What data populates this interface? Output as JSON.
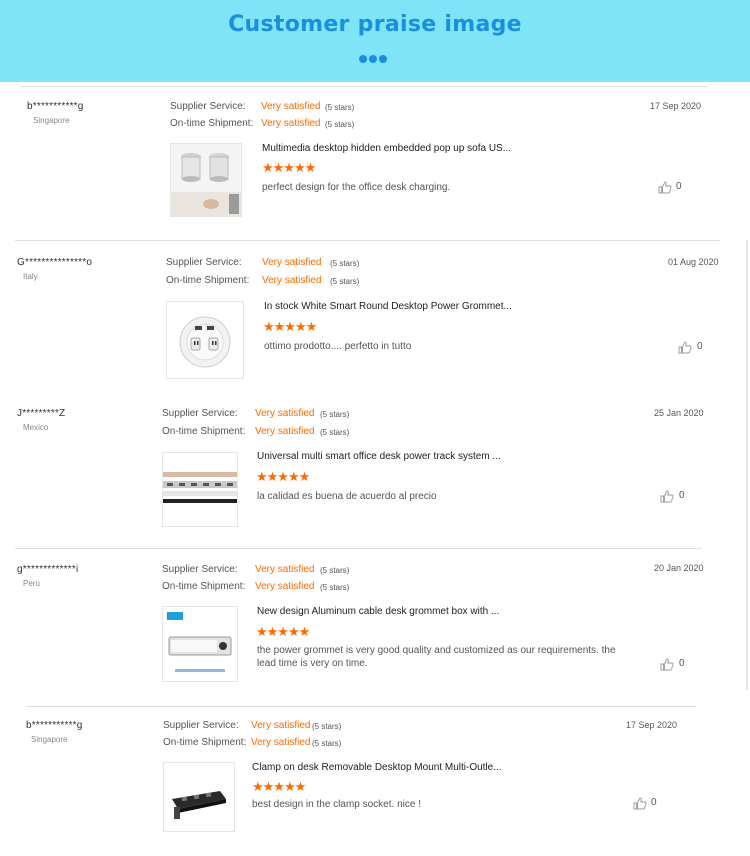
{
  "header": {
    "title": "Customer praise image"
  },
  "icons": {
    "dots": "three-dots-icon",
    "star": "star-icon",
    "like": "thumbs-up-icon"
  },
  "colors": {
    "header_bg": "#80e4f9",
    "accent": "#1a8fe0",
    "star": "#ff6a00"
  },
  "reviews": [
    {
      "username": "b***********g",
      "country": "Singapore",
      "service_label": "Supplier Service:",
      "service_rating": "Very satisfied",
      "service_note": "(5 stars)",
      "shipment_label": "On-time Shipment:",
      "shipment_rating": "Very satisfied",
      "shipment_note": "(5 stars)",
      "date": "17 Sep 2020",
      "product_title": "Multimedia desktop hidden embedded pop up sofa US...",
      "stars": 5,
      "comment": "perfect design for the office desk charging.",
      "likes": "0"
    },
    {
      "username": "G***************o",
      "country": "Italy",
      "service_label": "Supplier Service:",
      "service_rating": "Very satisfied",
      "service_note": "(5 stars)",
      "shipment_label": "On-time Shipment:",
      "shipment_rating": "Very satisfied",
      "shipment_note": "(5 stars)",
      "date": "01 Aug 2020",
      "product_title": "In stock White Smart Round Desktop Power Grommet...",
      "stars": 5,
      "comment": "ottimo prodotto.... perfetto in tutto",
      "likes": "0"
    },
    {
      "username": "J*********Z",
      "country": "Mexico",
      "service_label": "Supplier Service:",
      "service_rating": "Very satisfied",
      "service_note": "(5 stars)",
      "shipment_label": "On-time Shipment:",
      "shipment_rating": "Very satisfied",
      "shipment_note": "(5 stars)",
      "date": "25 Jan 2020",
      "product_title": "Universal multi smart office desk power track system ...",
      "stars": 5,
      "comment": "la  calidad es  buena  de acuerdo al  precio",
      "likes": "0"
    },
    {
      "username": "g*************i",
      "country": "Peru",
      "service_label": "Supplier Service:",
      "service_rating": "Very satisfied",
      "service_note": "(5 stars)",
      "shipment_label": "On-time Shipment:",
      "shipment_rating": "Very satisfied",
      "shipment_note": "(5 stars)",
      "date": "20 Jan 2020",
      "product_title": "New design Aluminum cable desk grommet box with ...",
      "stars": 5,
      "comment": "the power grommet is very good quality and customized as our  requirements. the lead time is very on time.",
      "likes": "0"
    },
    {
      "username": "b***********g",
      "country": "Singapore",
      "service_label": "Supplier Service:",
      "service_rating": "Very satisfied",
      "service_note": "(5 stars)",
      "shipment_label": "On-time Shipment:",
      "shipment_rating": "Very satisfied",
      "shipment_note": "(5 stars)",
      "date": "17 Sep 2020",
      "product_title": "Clamp on desk Removable Desktop Mount Multi-Outle...",
      "stars": 5,
      "comment": "best design in the clamp socket. nice !",
      "likes": "0"
    }
  ]
}
